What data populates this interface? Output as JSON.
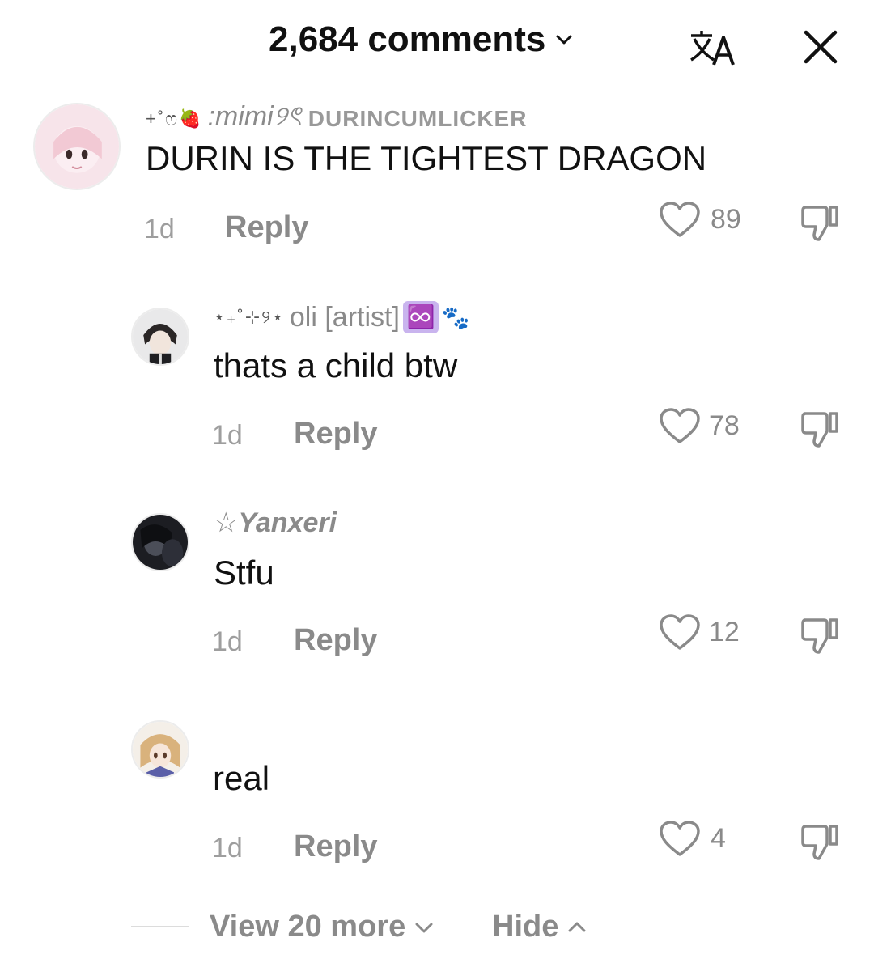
{
  "header": {
    "title": "2,684 comments",
    "translate_icon": "translate-icon",
    "close_icon": "close-icon"
  },
  "comments": [
    {
      "username_deco": "+˚ෆ🍓",
      "username": ":mimi୨ৎ",
      "username_suffix": "DURINCUMLICKER",
      "text": "DURIN IS THE TIGHTEST DRAGON",
      "time": "1d",
      "reply_label": "Reply",
      "likes": "89"
    },
    {
      "username_deco": "⋆₊˚⊹୨⋆",
      "username": "oli [artist]",
      "username_emoji": "♾️",
      "username_emoji2": "🐾",
      "text": "thats a child btw",
      "time": "1d",
      "reply_label": "Reply",
      "likes": "78"
    },
    {
      "username_deco": "☆",
      "username": "Yanxeri",
      "text": "Stfu",
      "time": "1d",
      "reply_label": "Reply",
      "likes": "12"
    },
    {
      "username": "",
      "text": "real",
      "time": "1d",
      "reply_label": "Reply",
      "likes": "4"
    }
  ],
  "footer": {
    "view_more_label": "View 20 more",
    "hide_label": "Hide"
  },
  "colors": {
    "text": "#111111",
    "muted": "#8a8a8a",
    "emoji_box": "#c9b4ee"
  }
}
